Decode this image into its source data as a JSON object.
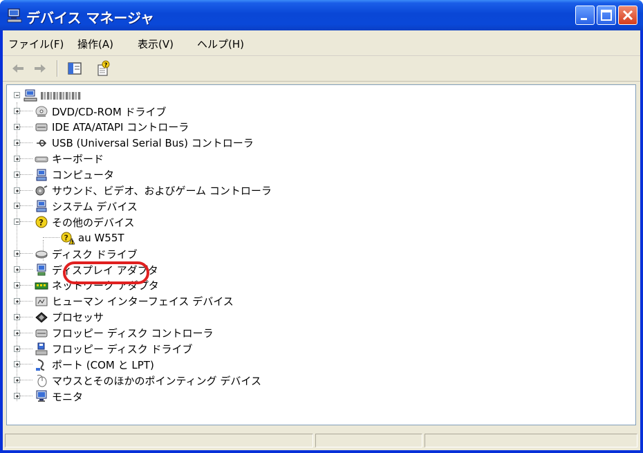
{
  "window": {
    "title": "デバイス マネージャ",
    "accent_color": "#0a47d6",
    "highlight_color": "#e02020"
  },
  "menubar": {
    "items": [
      {
        "label": "ファイル(F)"
      },
      {
        "label": "操作(A)"
      },
      {
        "label": "表示(V)"
      },
      {
        "label": "ヘルプ(H)"
      }
    ]
  },
  "toolbar": {
    "buttons": [
      {
        "icon": "back-arrow-icon"
      },
      {
        "icon": "forward-arrow-icon"
      },
      {
        "icon": "show-hide-console-tree-icon"
      },
      {
        "icon": "properties-help-icon"
      }
    ]
  },
  "tree": {
    "root": {
      "icon": "computer-icon"
    },
    "categories": [
      {
        "label": "DVD/CD-ROM ドライブ",
        "icon": "cdrom-drive-icon"
      },
      {
        "label": "IDE ATA/ATAPI コントローラ",
        "icon": "ide-controller-icon"
      },
      {
        "label": "USB (Universal Serial Bus) コントローラ",
        "icon": "usb-icon"
      },
      {
        "label": "キーボード",
        "icon": "keyboard-icon"
      },
      {
        "label": "コンピュータ",
        "icon": "computer-icon"
      },
      {
        "label": "サウンド、ビデオ、およびゲーム コントローラ",
        "icon": "sound-icon"
      },
      {
        "label": "システム デバイス",
        "icon": "system-device-icon"
      },
      {
        "label": "その他のデバイス",
        "icon": "unknown-device-icon",
        "expanded": true,
        "children": [
          {
            "label": "au W55T",
            "icon": "warning-device-icon"
          }
        ]
      },
      {
        "label": "ディスク ドライブ",
        "icon": "disk-drive-icon"
      },
      {
        "label": "ディスプレイ アダプタ",
        "icon": "display-adapter-icon"
      },
      {
        "label": "ネットワーク アダプタ",
        "icon": "network-adapter-icon"
      },
      {
        "label": "ヒューマン インターフェイス デバイス",
        "icon": "hid-icon"
      },
      {
        "label": "プロセッサ",
        "icon": "processor-icon"
      },
      {
        "label": "フロッピー ディスク コントローラ",
        "icon": "floppy-controller-icon"
      },
      {
        "label": "フロッピー ディスク ドライブ",
        "icon": "floppy-drive-icon"
      },
      {
        "label": "ポート (COM と LPT)",
        "icon": "port-icon"
      },
      {
        "label": "マウスとそのほかのポインティング デバイス",
        "icon": "mouse-icon"
      },
      {
        "label": "モニタ",
        "icon": "monitor-icon"
      }
    ]
  }
}
